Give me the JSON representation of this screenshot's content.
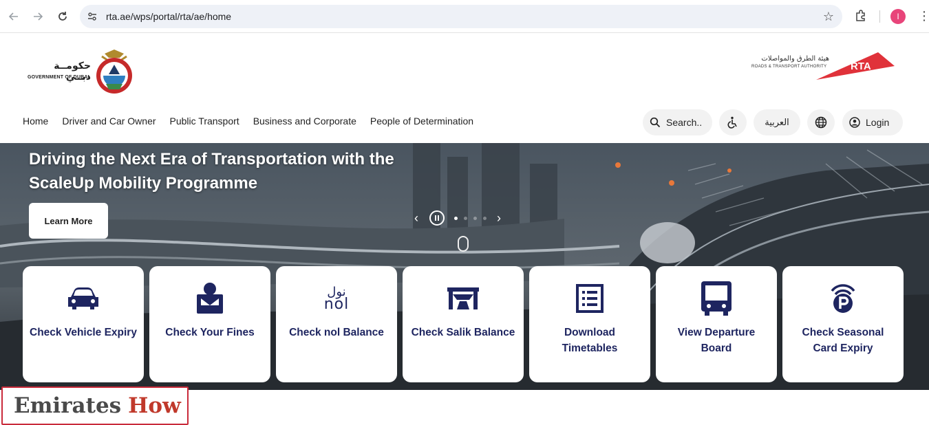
{
  "browser": {
    "url": "rta.ae/wps/portal/rta/ae/home",
    "profile_initial": "I"
  },
  "header": {
    "dubai_logo_ar": "حكومــة دبــي",
    "dubai_logo_en": "GOVERNMENT OF DUBAI",
    "rta_logo_ar": "هيئة الطرق والمواصلات",
    "rta_logo_en": "ROADS & TRANSPORT AUTHORITY",
    "rta_logo_mark": "RTA"
  },
  "nav": {
    "items": [
      "Home",
      "Driver and Car Owner",
      "Public Transport",
      "Business and Corporate",
      "People of Determination"
    ],
    "search_placeholder": "Search..",
    "language": "العربية",
    "login": "Login"
  },
  "hero": {
    "title_line1": "Driving the Next Era of Transportation with the",
    "title_line2": "ScaleUp Mobility Programme",
    "cta": "Learn More",
    "slide_count": 4,
    "active_slide": 1
  },
  "services": [
    {
      "label": "Check Vehicle Expiry",
      "icon": "car-icon"
    },
    {
      "label": "Check Your Fines",
      "icon": "fines-icon"
    },
    {
      "label": "Check nol Balance",
      "icon": "nol-icon",
      "icon_text_ar": "نول",
      "icon_text_en": "nol"
    },
    {
      "label": "Check Salik Balance",
      "icon": "salik-gate-icon"
    },
    {
      "label": "Download Timetables",
      "icon": "timetable-icon"
    },
    {
      "label": "View Departure Board",
      "icon": "bus-icon"
    },
    {
      "label": "Check Seasonal Card Expiry",
      "icon": "parking-icon"
    }
  ],
  "watermark": {
    "part1": "Emirates",
    "part2": "How"
  },
  "colors": {
    "service_text": "#1e2560",
    "rta_red": "#e0323a",
    "watermark_red": "#c0392b"
  }
}
